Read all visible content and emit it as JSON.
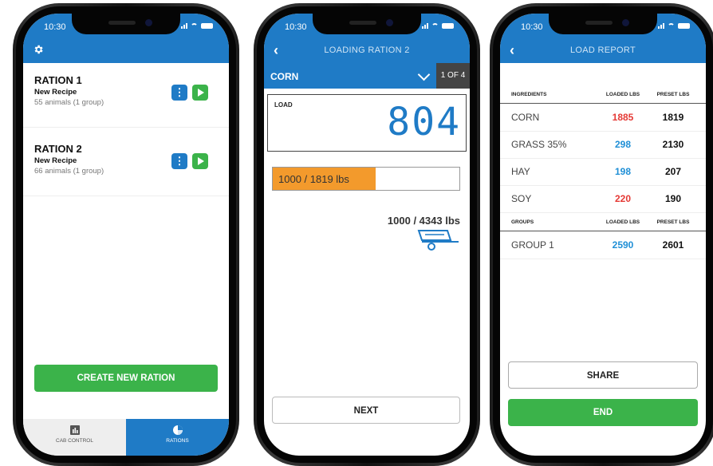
{
  "status": {
    "time": "10:30"
  },
  "colors": {
    "primary": "#1f7bc6",
    "green": "#3bb34a",
    "orange": "#f39a2c",
    "red": "#e53935",
    "blue_value": "#1f8fd6"
  },
  "screen1": {
    "rations": [
      {
        "title": "RATION 1",
        "recipe": "New Recipe",
        "animals": "55 animals (1 group)"
      },
      {
        "title": "RATION 2",
        "recipe": "New Recipe",
        "animals": "66 animals (1 group)"
      }
    ],
    "create_label": "CREATE NEW RATION",
    "tabs": [
      {
        "label": "CAB CONTROL",
        "icon": "bar-chart-icon"
      },
      {
        "label": "RATIONS",
        "icon": "pie-chart-icon",
        "active": true
      }
    ]
  },
  "screen2": {
    "title": "LOADING RATION 2",
    "ingredient": "CORN",
    "step": "1 OF 4",
    "load_label": "LOAD",
    "load_value": "804",
    "progress_text": "1000 / 1819 lbs",
    "progress_fraction": 0.5497,
    "total_text": "1000 / 4343 lbs",
    "next_label": "NEXT"
  },
  "screen3": {
    "title": "LOAD REPORT",
    "ingredients_header": {
      "name": "INGREDIENTS",
      "loaded": "LOADED LBS",
      "preset": "PRESET LBS"
    },
    "ingredients": [
      {
        "name": "CORN",
        "loaded": "1885",
        "preset": "1819",
        "status": "red"
      },
      {
        "name": "GRASS 35%",
        "loaded": "298",
        "preset": "2130",
        "status": "blue"
      },
      {
        "name": "HAY",
        "loaded": "198",
        "preset": "207",
        "status": "blue"
      },
      {
        "name": "SOY",
        "loaded": "220",
        "preset": "190",
        "status": "red"
      }
    ],
    "groups_header": {
      "name": "GROUPS",
      "loaded": "LOADED LBS",
      "preset": "PRESET LBS"
    },
    "groups": [
      {
        "name": "GROUP 1",
        "loaded": "2590",
        "preset": "2601",
        "status": "blue"
      }
    ],
    "share_label": "SHARE",
    "end_label": "END"
  }
}
